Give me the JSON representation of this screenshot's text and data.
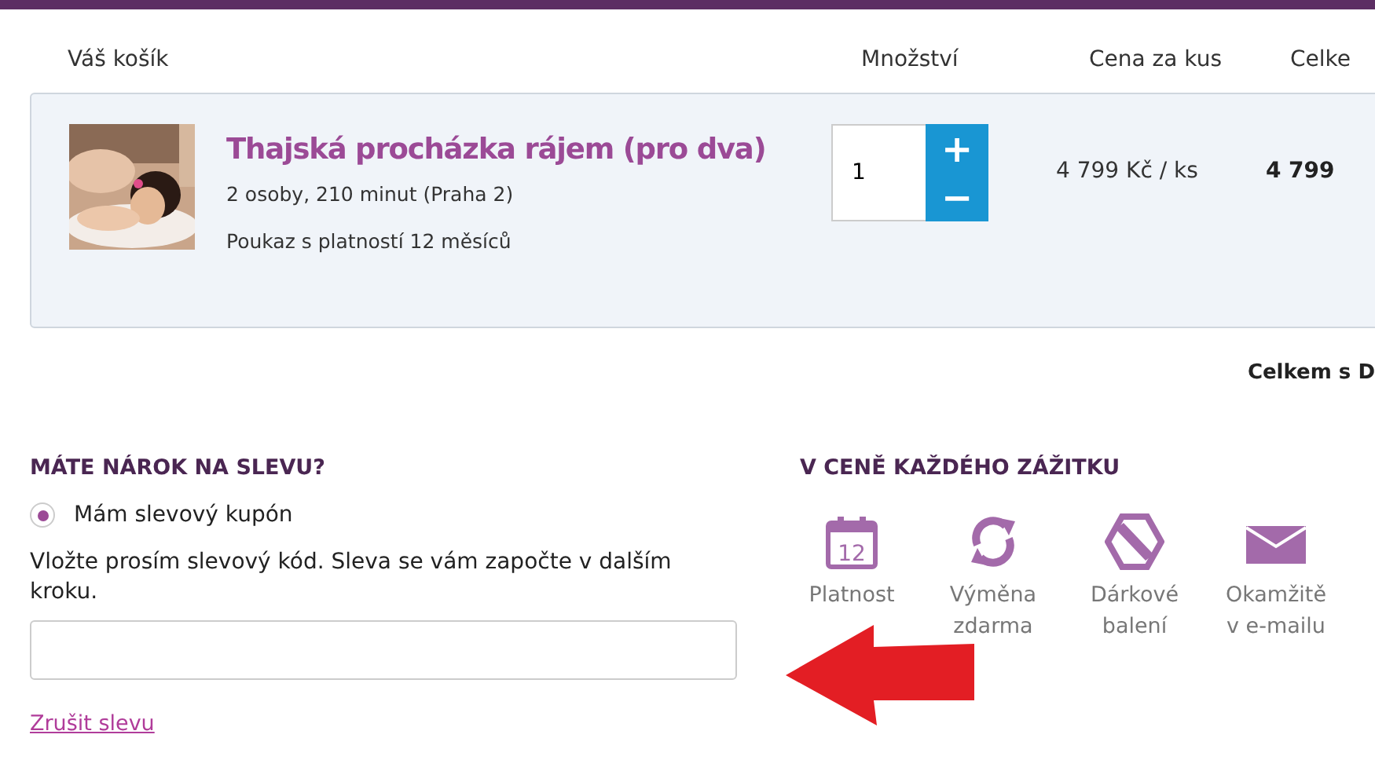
{
  "cart": {
    "columns": [
      "Váš košík",
      "Množství",
      "Cena za kus",
      "Celke"
    ],
    "items": [
      {
        "title": "Thajská procházka rájem (pro dva)",
        "details": "2 osoby, 210 minut (Praha 2)",
        "validity": "Poukaz s platností 12 měsíců",
        "quantity": "1",
        "plus": "+",
        "minus": "−",
        "unit_price": "4 799 Kč / ks",
        "total": "4 799"
      }
    ],
    "grand_total_label": "Celkem s D"
  },
  "discount": {
    "heading": "MÁTE NÁROK NA SLEVU?",
    "option": {
      "label": "Mám slevový kupón",
      "selected": true
    },
    "hint": "Vložte prosím slevový kód. Sleva se vám započte v dalším kroku.",
    "cancel_link": "Zrušit slevu"
  },
  "included": {
    "heading": "V CENĚ KAŽDÉHO ZÁŽITKU",
    "features": [
      {
        "kind": "calendar",
        "icon_text": "12",
        "lines": [
          "Platnost"
        ]
      },
      {
        "kind": "exchange",
        "lines": [
          "Výměna",
          "zdarma"
        ]
      },
      {
        "kind": "gift",
        "lines": [
          "Dárkové",
          "balení"
        ]
      },
      {
        "kind": "mail",
        "lines": [
          "Okamžitě",
          "v e-mailu"
        ]
      }
    ]
  }
}
